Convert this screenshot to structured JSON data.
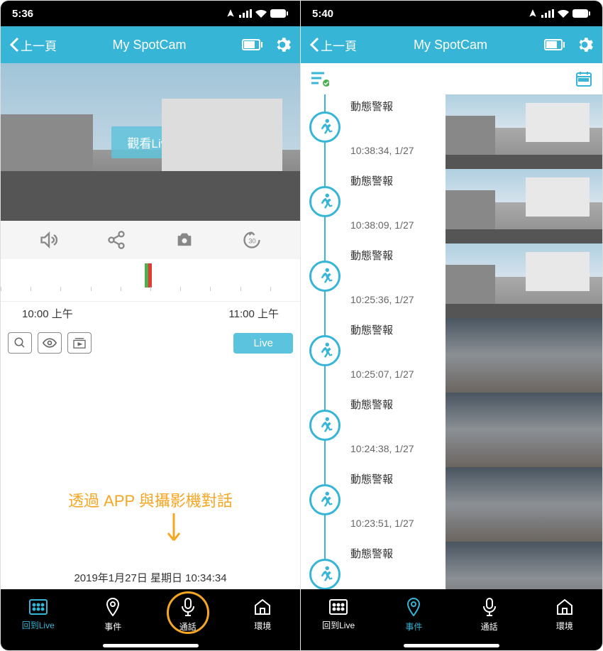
{
  "phone1": {
    "status": {
      "time": "5:36",
      "has_location": true
    },
    "nav": {
      "back": "上一頁",
      "title": "My SpotCam"
    },
    "live_overlay": "觀看Live",
    "time_labels": {
      "left": "10:00 上午",
      "right": "11:00 上午"
    },
    "live_button": "Live",
    "annotation": "透過 APP 與攝影機對話",
    "datetime": "2019年1月27日 星期日 10:34:34",
    "tabs": [
      {
        "label": "回到Live",
        "icon": "grid",
        "active": true
      },
      {
        "label": "事件",
        "icon": "pin",
        "active": false
      },
      {
        "label": "通話",
        "icon": "mic",
        "active": false,
        "circled": true
      },
      {
        "label": "環境",
        "icon": "home",
        "active": false
      }
    ]
  },
  "phone2": {
    "status": {
      "time": "5:40",
      "has_location": true
    },
    "nav": {
      "back": "上一頁",
      "title": "My SpotCam"
    },
    "events": [
      {
        "title": "動態警報",
        "time": "10:38:34, 1/27",
        "thumb": 1
      },
      {
        "title": "動態警報",
        "time": "10:38:09, 1/27",
        "thumb": 1
      },
      {
        "title": "動態警報",
        "time": "10:25:36, 1/27",
        "thumb": 1
      },
      {
        "title": "動態警報",
        "time": "10:25:07, 1/27",
        "thumb": 2
      },
      {
        "title": "動態警報",
        "time": "10:24:38, 1/27",
        "thumb": 2
      },
      {
        "title": "動態警報",
        "time": "10:23:51, 1/27",
        "thumb": 2
      },
      {
        "title": "動態警報",
        "time": "",
        "thumb": 2
      }
    ],
    "tabs": [
      {
        "label": "回到Live",
        "icon": "grid",
        "active": false
      },
      {
        "label": "事件",
        "icon": "pin",
        "active": true
      },
      {
        "label": "通話",
        "icon": "mic",
        "active": false
      },
      {
        "label": "環境",
        "icon": "home",
        "active": false
      }
    ]
  }
}
